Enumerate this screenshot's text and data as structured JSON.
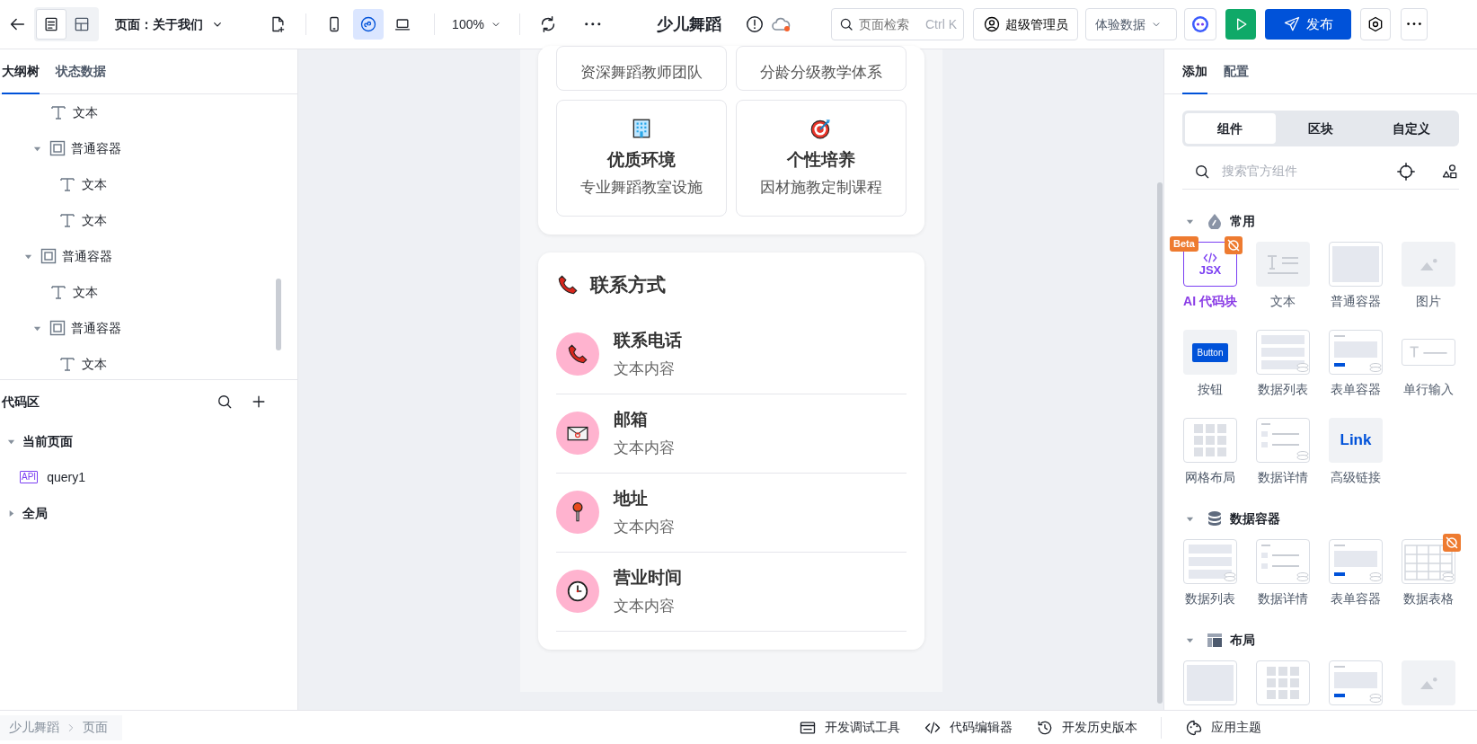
{
  "toolbar": {
    "panel_modes": [
      {
        "kind": "outline",
        "selected": true
      },
      {
        "kind": "layout",
        "selected": false
      }
    ],
    "page_label": "页面：关于我们",
    "view_modes": [
      {
        "kind": "mobile",
        "selected": false
      },
      {
        "kind": "miniapp",
        "selected": true
      },
      {
        "kind": "desktop",
        "selected": false
      }
    ],
    "zoom": "100%",
    "app_title": "少儿舞蹈",
    "unsaved": true,
    "search": {
      "placeholder": "页面检索",
      "shortcut": "Ctrl K"
    },
    "user": "超级管理员",
    "data_mode": "体验数据",
    "publish": "发布"
  },
  "left_panel": {
    "tabs": [
      {
        "label": "大纲树",
        "selected": true
      },
      {
        "label": "状态数据",
        "selected": false
      }
    ],
    "tree": [
      {
        "children": [
          {
            "kind": "text",
            "label": "文本"
          },
          {
            "kind": "container",
            "label": "普通容器",
            "expanded": true,
            "children": [
              {
                "kind": "text",
                "label": "文本"
              },
              {
                "kind": "text",
                "label": "文本"
              }
            ]
          }
        ]
      },
      {
        "kind": "container",
        "label": "普通容器",
        "expanded": true,
        "children": [
          {
            "kind": "text",
            "label": "文本"
          },
          {
            "kind": "container",
            "label": "普通容器",
            "expanded": true,
            "children": [
              {
                "kind": "text",
                "label": "文本"
              }
            ]
          }
        ]
      }
    ],
    "code_area": {
      "title": "代码区",
      "groups": [
        {
          "label": "当前页面",
          "expanded": true,
          "items": [
            {
              "badge": "API",
              "label": "query1"
            }
          ]
        },
        {
          "label": "全局",
          "expanded": false
        }
      ]
    }
  },
  "preview": {
    "features_cut": [
      {
        "subtitle": "资深舞蹈教师团队"
      },
      {
        "subtitle": "分龄分级教学体系"
      }
    ],
    "features": [
      {
        "kind": "building",
        "title": "优质环境",
        "subtitle": "专业舞蹈教室设施"
      },
      {
        "kind": "target",
        "title": "个性培养",
        "subtitle": "因材施教定制课程"
      }
    ],
    "contact": {
      "title": "联系方式",
      "items": [
        {
          "kind": "phone",
          "title": "联系电话",
          "value": "文本内容"
        },
        {
          "kind": "mail",
          "title": "邮箱",
          "value": "文本内容"
        },
        {
          "kind": "pin",
          "title": "地址",
          "value": "文本内容"
        },
        {
          "kind": "clock",
          "title": "营业时间",
          "value": "文本内容"
        }
      ]
    }
  },
  "right_panel": {
    "tabs": [
      {
        "label": "添加",
        "selected": true
      },
      {
        "label": "配置",
        "selected": false
      }
    ],
    "segments": [
      {
        "label": "组件",
        "selected": true
      },
      {
        "label": "区块",
        "selected": false
      },
      {
        "label": "自定义",
        "selected": false
      }
    ],
    "search": {
      "placeholder": "搜索官方组件"
    },
    "sections": [
      {
        "kind": "common",
        "title": "常用",
        "expanded": true,
        "items": [
          {
            "kind": "jsx",
            "label": "AI 代码块",
            "thumb_text": "JSX",
            "badge": "Beta",
            "ai": true
          },
          {
            "kind": "text",
            "label": "文本"
          },
          {
            "kind": "container",
            "label": "普通容器"
          },
          {
            "kind": "image",
            "label": "图片"
          },
          {
            "kind": "button",
            "label": "按钮",
            "thumb_text": "Button"
          },
          {
            "kind": "list",
            "label": "数据列表"
          },
          {
            "kind": "form",
            "label": "表单容器"
          },
          {
            "kind": "input",
            "label": "单行输入"
          },
          {
            "kind": "grid",
            "label": "网格布局"
          },
          {
            "kind": "detail",
            "label": "数据详情"
          },
          {
            "kind": "link",
            "label": "高级链接",
            "thumb_text": "Link"
          }
        ]
      },
      {
        "kind": "data",
        "title": "数据容器",
        "expanded": true,
        "items": [
          {
            "kind": "list",
            "label": "数据列表"
          },
          {
            "kind": "detail",
            "label": "数据详情"
          },
          {
            "kind": "form",
            "label": "表单容器"
          },
          {
            "kind": "table",
            "label": "数据表格",
            "ai": true
          }
        ]
      },
      {
        "kind": "layout",
        "title": "布局",
        "expanded": true,
        "items": [
          {
            "kind": "container"
          },
          {
            "kind": "grid"
          },
          {
            "kind": "form"
          },
          {
            "kind": "image"
          }
        ]
      }
    ]
  },
  "status_bar": {
    "breadcrumb": [
      "少儿舞蹈",
      "页面"
    ],
    "tools": [
      {
        "kind": "debug",
        "label": "开发调试工具"
      },
      {
        "kind": "code",
        "label": "代码编辑器"
      },
      {
        "kind": "history",
        "label": "开发历史版本"
      },
      {
        "kind": "palette",
        "label": "应用主题"
      }
    ]
  }
}
